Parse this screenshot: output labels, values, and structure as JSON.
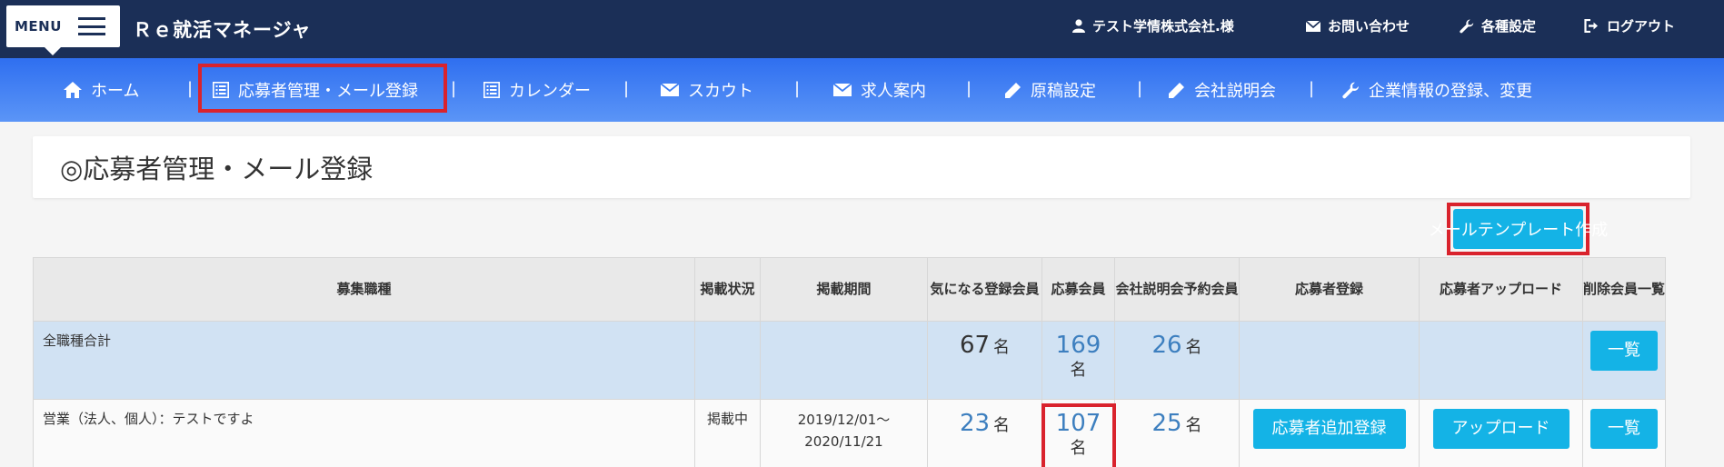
{
  "header": {
    "menu_label": "MENU",
    "app_title": "Ｒｅ就活マネージャ",
    "user_label": "テスト学情株式会社.様",
    "contact_label": "お問い合わせ",
    "settings_label": "各種設定",
    "logout_label": "ログアウト"
  },
  "nav": {
    "items": [
      {
        "label": "ホーム",
        "icon": "home-icon"
      },
      {
        "label": "応募者管理・メール登録",
        "icon": "list-icon"
      },
      {
        "label": "カレンダー",
        "icon": "list-icon"
      },
      {
        "label": "スカウト",
        "icon": "envelope-icon"
      },
      {
        "label": "求人案内",
        "icon": "envelope-icon"
      },
      {
        "label": "原稿設定",
        "icon": "pencil-icon"
      },
      {
        "label": "会社説明会",
        "icon": "pencil-icon"
      },
      {
        "label": "企業情報の登録、変更",
        "icon": "wrench-icon"
      }
    ],
    "separator": "|"
  },
  "page": {
    "title": "◎応募者管理・メール登録",
    "template_button": "メールテンプレート作成"
  },
  "table": {
    "headers": [
      "募集職種",
      "掲載状況",
      "掲載期間",
      "気になる登録会員",
      "応募会員",
      "会社説明会予約会員",
      "応募者登録",
      "応募者アップロード",
      "削除会員一覧"
    ],
    "unit": "名",
    "total_row": {
      "job": "全職種合計",
      "status": "",
      "period": "",
      "interested": "67",
      "applicants": "169",
      "briefing": "26",
      "list_button": "一覧"
    },
    "rows": [
      {
        "job": "営業（法人、個人）：テストですよ",
        "status": "掲載中",
        "period": "2019/12/01～2020/11/21",
        "interested": "23",
        "applicants": "107",
        "briefing": "25",
        "add_button": "応募者追加登録",
        "upload_button": "アップロード",
        "list_button": "一覧"
      }
    ]
  },
  "colors": {
    "topbar": "#1b2f57",
    "navbar": "#2f6ff0",
    "accent_button": "#14b3e6",
    "highlight": "#d9232d",
    "link_number": "#3d7fbf",
    "total_row_bg": "#d1e2f3"
  }
}
